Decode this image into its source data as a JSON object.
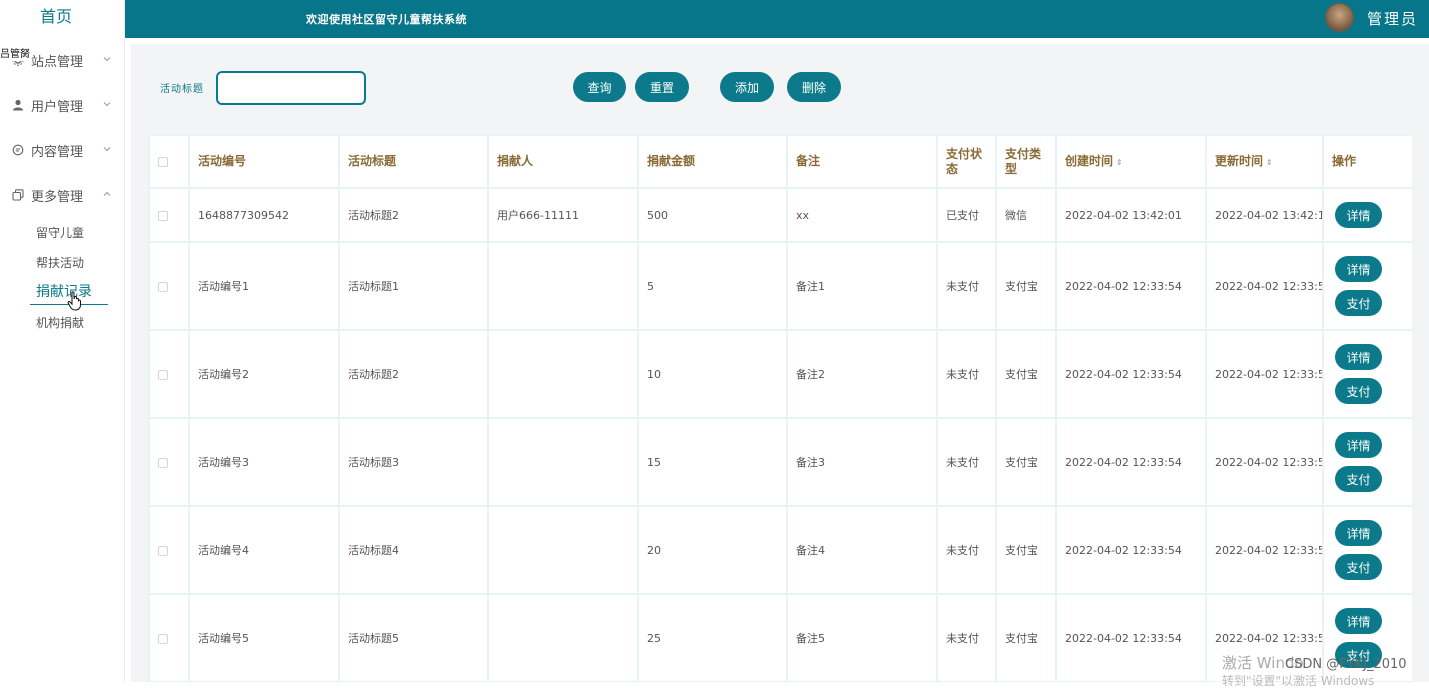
{
  "app": {
    "home": "首页",
    "welcome": "欢迎使用社区留守儿童帮扶系统",
    "admin": "管理员",
    "accent": "#08768a"
  },
  "sidebar": {
    "glitch_text": "吕管胬",
    "menus": [
      {
        "label": "站点管理",
        "icon": "gear-icon",
        "expanded": false
      },
      {
        "label": "用户管理",
        "icon": "user-icon",
        "expanded": false
      },
      {
        "label": "内容管理",
        "icon": "message-icon",
        "expanded": false
      },
      {
        "label": "更多管理",
        "icon": "copy-icon",
        "expanded": true
      }
    ],
    "sub_items": [
      {
        "label": "留守儿童"
      },
      {
        "label": "帮扶活动"
      },
      {
        "label": "捐献记录",
        "active": true
      },
      {
        "label": "机构捐献"
      }
    ]
  },
  "search": {
    "label": "活动标题",
    "value": ""
  },
  "toolbar": {
    "query": "查询",
    "reset": "重置",
    "add": "添加",
    "delete": "删除"
  },
  "table": {
    "headers": [
      "活动编号",
      "活动标题",
      "捐献人",
      "捐献金额",
      "备注",
      "支付状态",
      "支付类型",
      "创建时间",
      "更新时间",
      "操作"
    ],
    "detail_label": "详情",
    "pay_label": "支付",
    "rows": [
      {
        "id": "1648877309542",
        "title": "活动标题2",
        "donor": "用户666-11111",
        "amount": "500",
        "note": "xx",
        "status": "已支付",
        "pay_type": "微信",
        "created": "2022-04-02 13:42:01",
        "updated": "2022-04-02 13:42:1"
      },
      {
        "id": "活动编号1",
        "title": "活动标题1",
        "donor": "",
        "amount": "5",
        "note": "备注1",
        "status": "未支付",
        "pay_type": "支付宝",
        "created": "2022-04-02 12:33:54",
        "updated": "2022-04-02 12:33:5"
      },
      {
        "id": "活动编号2",
        "title": "活动标题2",
        "donor": "",
        "amount": "10",
        "note": "备注2",
        "status": "未支付",
        "pay_type": "支付宝",
        "created": "2022-04-02 12:33:54",
        "updated": "2022-04-02 12:33:5"
      },
      {
        "id": "活动编号3",
        "title": "活动标题3",
        "donor": "",
        "amount": "15",
        "note": "备注3",
        "status": "未支付",
        "pay_type": "支付宝",
        "created": "2022-04-02 12:33:54",
        "updated": "2022-04-02 12:33:5"
      },
      {
        "id": "活动编号4",
        "title": "活动标题4",
        "donor": "",
        "amount": "20",
        "note": "备注4",
        "status": "未支付",
        "pay_type": "支付宝",
        "created": "2022-04-02 12:33:54",
        "updated": "2022-04-02 12:33:5"
      },
      {
        "id": "活动编号5",
        "title": "活动标题5",
        "donor": "",
        "amount": "25",
        "note": "备注5",
        "status": "未支付",
        "pay_type": "支付宝",
        "created": "2022-04-02 12:33:54",
        "updated": "2022-04-02 12:33:5"
      }
    ]
  },
  "watermarks": {
    "activate_line1": "激活 Windo",
    "activate_line2": "转到\"设置\"以激活 Windows",
    "csdn": "CSDN @FYKJ_2010"
  }
}
